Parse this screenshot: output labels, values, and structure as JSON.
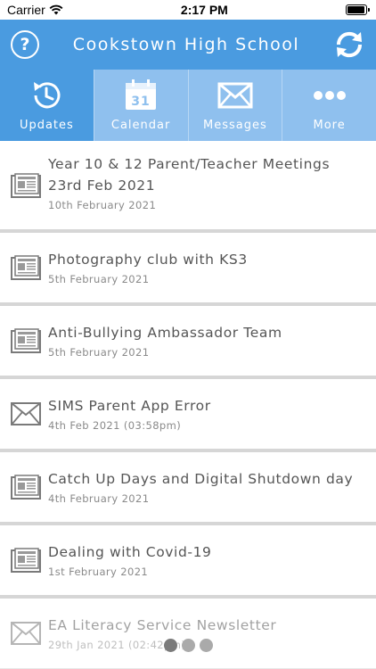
{
  "status_bar": {
    "carrier": "Carrier",
    "time": "2:17 PM",
    "battery_level": 0.95
  },
  "header": {
    "title": "Cookstown High School",
    "help_icon": "question-circle-icon",
    "refresh_icon": "refresh-icon",
    "accent": "#4a9be0"
  },
  "tabs": [
    {
      "label": "Updates",
      "icon": "clock-history-icon",
      "active": true
    },
    {
      "label": "Calendar",
      "icon": "calendar-icon",
      "day": "31",
      "active": false
    },
    {
      "label": "Messages",
      "icon": "envelope-icon",
      "active": false
    },
    {
      "label": "More",
      "icon": "ellipsis-icon",
      "active": false
    }
  ],
  "feed": [
    {
      "title": "Year 10 & 12 Parent/Teacher Meetings 23rd Feb 2021",
      "date": "10th February 2021",
      "icon": "newspaper-icon"
    },
    {
      "title": "Photography club with KS3",
      "date": "5th February 2021",
      "icon": "newspaper-icon"
    },
    {
      "title": "Anti-Bullying Ambassador Team",
      "date": "5th February 2021",
      "icon": "newspaper-icon"
    },
    {
      "title": "SIMS Parent App Error",
      "date": "4th Feb 2021 (03:58pm)",
      "icon": "envelope-icon"
    },
    {
      "title": "Catch Up Days and Digital Shutdown day",
      "date": "4th February 2021",
      "icon": "newspaper-icon"
    },
    {
      "title": "Dealing with Covid-19",
      "date": "1st February 2021",
      "icon": "newspaper-icon"
    },
    {
      "title": "EA Literacy Service Newsletter",
      "date": "29th Jan 2021 (02:42pm)",
      "icon": "envelope-icon"
    }
  ],
  "pager": {
    "pages": 3,
    "current": 1
  }
}
